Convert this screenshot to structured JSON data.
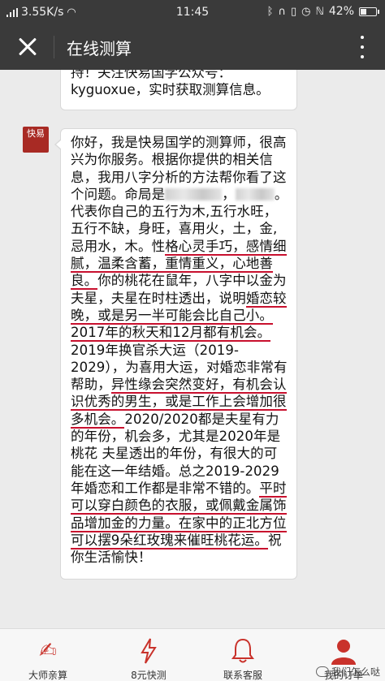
{
  "status_bar": {
    "network_speed": "3.55K/s",
    "time": "11:45",
    "battery": "42%",
    "battery_level": 0.42
  },
  "nav": {
    "title": "在线测算"
  },
  "messages": {
    "top_line1": "持！关注快易国学公众号：",
    "top_line2": "kyguoxue，实时获取测算信息。",
    "avatar_text": "快易",
    "main": {
      "p1": "你好，我是快易国学的测算师，很高兴为你服务。根据你提供的相关信息，我用八字分析的方法帮你看了这个问题。命局是",
      "p2": "代表你自己的五行为木,五行水旺，五行不缺，身旺，喜用火，土，金,忌用水，木。性",
      "h1": "格心灵手巧，感情细腻，温柔含蓄，重情重义，心地善良。",
      "p3": "你的桃花在鼠年，八字中以金为夫星，夫星在时柱透出，说明",
      "h2": "婚恋较晚，或是另一半可能会比自己小。2017年的秋天和12月都有机会。",
      "p4": "2019年换官杀大运（2019-2029），为喜用大运，对婚恋非常有帮助，",
      "h3": "异性缘会突然变好，有机会认识优秀的男生，或是工作上会增加很多机会。",
      "p5": "2020/2020都是夫星有力的年份，机会多，尤其是2020年是桃花 夫星透出的年份，有很大的可能在这一年结婚。总之2019-2029年婚恋和工作都是非常不错的。",
      "h4": "平时可以穿白颜色的衣服，或佩戴金属饰品增加金的力量。在家中的正北方位可以摆9朵红玫瑰来催旺桃花运。",
      "p6": "祝你生活愉快！"
    }
  },
  "tabs": [
    {
      "label": "大师亲算",
      "icon": "hand-icon"
    },
    {
      "label": "8元快测",
      "icon": "lightning-icon"
    },
    {
      "label": "联系客服",
      "icon": "bell-icon"
    },
    {
      "label": "我的订单",
      "icon": "person-icon"
    }
  ],
  "watermark": "我们怎么哒",
  "colors": {
    "bar_bg": "#3a3a3a",
    "accent_red": "#c9322b",
    "underline": "#c8102e"
  }
}
